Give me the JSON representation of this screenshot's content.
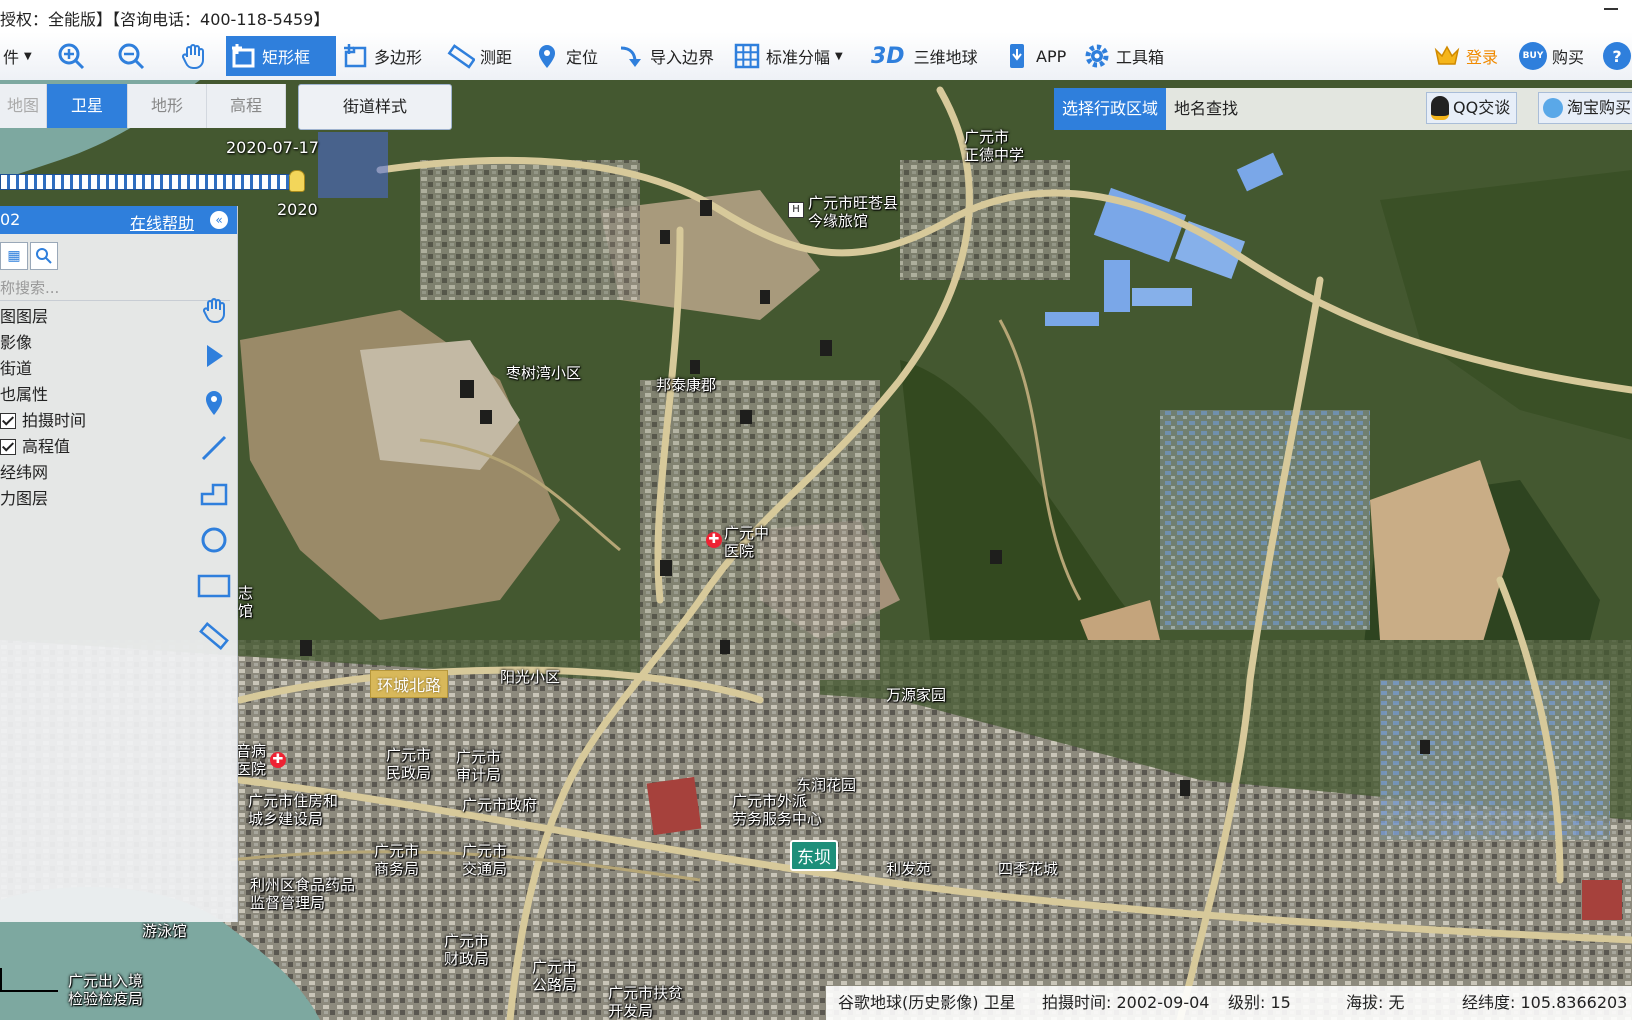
{
  "title": {
    "license": "授权：全能版】",
    "hotline": "【咨询电话：400-118-5459】"
  },
  "toolbar": {
    "file": "件",
    "rect": "矩形框",
    "polygon": "多边形",
    "measure": "测距",
    "locate": "定位",
    "import": "导入边界",
    "tiles": "标准分幅",
    "three_d_badge": "3D",
    "globe": "三维地球",
    "app": "APP",
    "toolbox": "工具箱",
    "login": "登录",
    "buy_badge": "BUY",
    "buy": "购买",
    "help": "?"
  },
  "map_tabs": [
    "地图",
    "卫星",
    "地形",
    "高程"
  ],
  "active_map_tab": "卫星",
  "street_style": "街道样式",
  "timeline": {
    "date_top": "2020-07-17",
    "date_bottom": "2020",
    "position": 0.96
  },
  "panel": {
    "code": "02",
    "help": "在线帮助",
    "search_placeholder": "称搜索...",
    "layers": [
      {
        "label": "图图层",
        "check": null
      },
      {
        "label": "影像",
        "check": null
      },
      {
        "label": "街道",
        "check": null
      },
      {
        "label": "也属性",
        "check": null
      },
      {
        "label": "拍摄时间",
        "check": true
      },
      {
        "label": "高程值",
        "check": true
      },
      {
        "label": "经纬网",
        "check": null
      },
      {
        "label": "力图层",
        "check": null
      }
    ]
  },
  "region": {
    "select": "选择行政区域",
    "search": "地名查找"
  },
  "qq": "QQ交谈",
  "taobao": "淘宝购买",
  "places": {
    "p1": "广元市\n正德中学",
    "p2": "广元市旺苍县\n今缘旅馆",
    "p3": "枣树湾小区",
    "p4": "邦泰康郡",
    "p5": "广元中\n医院",
    "p6": "阳光小区",
    "p7": "万源家园",
    "p8": "广元市\n民政局",
    "p9": "广元市\n审计局",
    "p10": "广元市政府",
    "p11": "东润花园",
    "p12": "广元市外派\n劳务服务中心",
    "p13": "广元市住房和\n城乡建设局",
    "p14": "广元市\n商务局",
    "p15": "广元市\n交通局",
    "p16": "利发苑",
    "p17": "四季花城",
    "p18": "利州区食品药品\n监督管理局",
    "p19": "广元市\n财政局",
    "p20": "广元市\n公路局",
    "p21": "广元市扶贫\n开发局",
    "p22": "广元出入境\n检验检疫局",
    "p23": "游泳馆",
    "p24": "音病\n医院",
    "p25": "志\n馆"
  },
  "road_badge": "环城北路",
  "metro": "东坝",
  "status": {
    "source": "谷歌地球(历史影像) 卫星",
    "shot_time": "拍摄时间: 2002-09-04",
    "level": "级别:  15",
    "altitude": "海拔: 无",
    "lon": "经纬度:  105.8366203"
  },
  "colors": {
    "accent": "#2f7fdc",
    "login": "#f08a00",
    "road": "#d8b85a"
  }
}
